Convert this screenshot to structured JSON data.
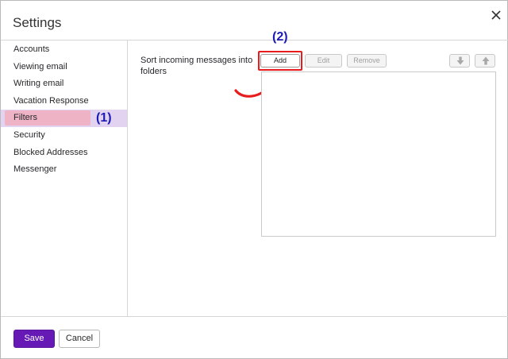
{
  "dialog": {
    "title": "Settings"
  },
  "sidebar": {
    "items": [
      {
        "label": "Accounts"
      },
      {
        "label": "Viewing email"
      },
      {
        "label": "Writing email"
      },
      {
        "label": "Vacation Response"
      },
      {
        "label": "Filters",
        "active": true
      },
      {
        "label": "Security"
      },
      {
        "label": "Blocked Addresses"
      },
      {
        "label": "Messenger"
      }
    ]
  },
  "annotations": {
    "step1": "(1)",
    "step2": "(2)",
    "highlight_color": "#e81c1c",
    "annotation_color": "#1c1cb4"
  },
  "filters": {
    "description": "Sort incoming messages into folders",
    "add_label": "Add",
    "edit_label": "Edit",
    "remove_label": "Remove",
    "move_down_icon": "arrow-down-icon",
    "move_up_icon": "arrow-up-icon",
    "items": []
  },
  "footer": {
    "save_label": "Save",
    "cancel_label": "Cancel"
  },
  "colors": {
    "accent": "#6619b5",
    "active_nav_bg": "#e2d3f0"
  }
}
